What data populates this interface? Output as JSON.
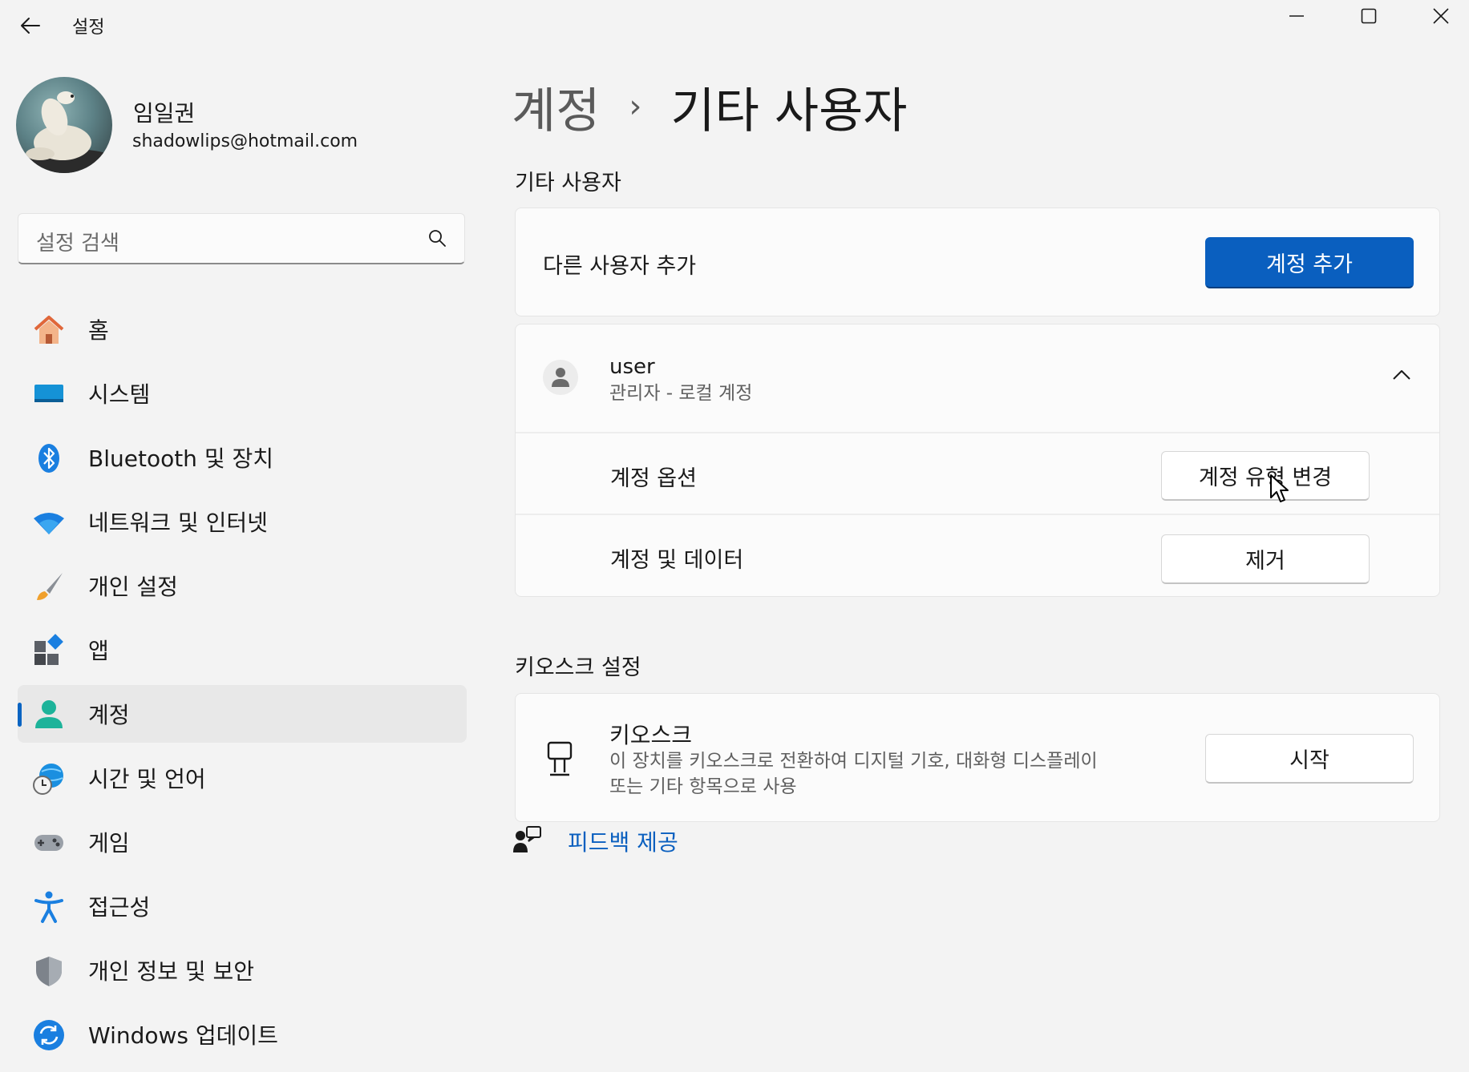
{
  "window": {
    "title": "설정"
  },
  "profile": {
    "name": "임일권",
    "email": "shadowlips@hotmail.com"
  },
  "search": {
    "placeholder": "설정 검색"
  },
  "sidebar": {
    "items": [
      {
        "label": "홈",
        "icon": "home-icon"
      },
      {
        "label": "시스템",
        "icon": "system-icon"
      },
      {
        "label": "Bluetooth 및 장치",
        "icon": "bluetooth-icon"
      },
      {
        "label": "네트워크 및 인터넷",
        "icon": "wifi-icon"
      },
      {
        "label": "개인 설정",
        "icon": "brush-icon"
      },
      {
        "label": "앱",
        "icon": "apps-icon"
      },
      {
        "label": "계정",
        "icon": "account-icon",
        "active": true
      },
      {
        "label": "시간 및 언어",
        "icon": "time-language-icon"
      },
      {
        "label": "게임",
        "icon": "gamepad-icon"
      },
      {
        "label": "접근성",
        "icon": "accessibility-icon"
      },
      {
        "label": "개인 정보 및 보안",
        "icon": "shield-icon"
      },
      {
        "label": "Windows 업데이트",
        "icon": "update-icon"
      }
    ]
  },
  "breadcrumb": {
    "parent": "계정",
    "separator": "›",
    "current": "기타 사용자"
  },
  "other_users": {
    "section_title": "기타 사용자",
    "add_label": "다른 사용자 추가",
    "add_button": "계정 추가",
    "user": {
      "name": "user",
      "subtitle": "관리자 - 로컬 계정",
      "options_label": "계정 옵션",
      "options_button": "계정 유형 변경",
      "data_label": "계정 및 데이터",
      "data_button": "제거"
    }
  },
  "kiosk": {
    "section_title": "키오스크 설정",
    "title": "키오스크",
    "description_line1": "이 장치를 키오스크로 전환하여 디지털 기호, 대화형 디스플레이",
    "description_line2": "또는 기타 항목으로 사용",
    "button": "시작"
  },
  "feedback": {
    "label": "피드백 제공"
  },
  "colors": {
    "accent": "#0a5fbf",
    "background": "#f3f3f3",
    "card": "#fbfbfb"
  }
}
